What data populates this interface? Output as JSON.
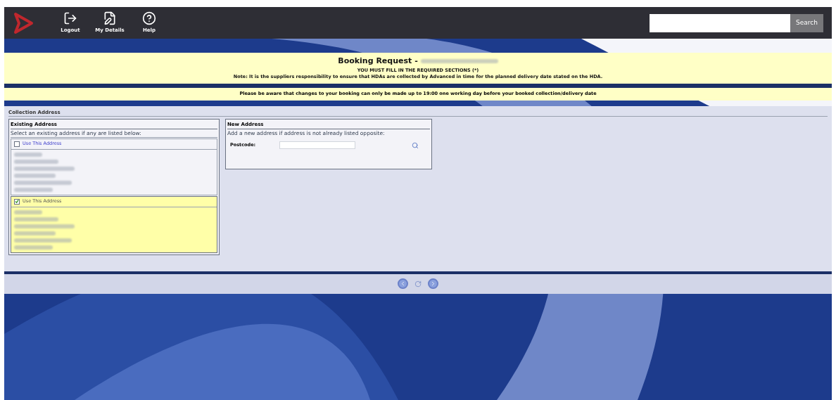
{
  "nav": [
    {
      "label": "Logout",
      "kind": "logout"
    },
    {
      "label": "My Details",
      "kind": "details"
    },
    {
      "label": "Help",
      "kind": "help"
    }
  ],
  "search": {
    "button": "Search"
  },
  "header": {
    "title": "Booking Request -",
    "required": "YOU MUST FILL IN THE REQUIRED SECTIONS (*)",
    "note": "Note: It is the suppliers responsibility to ensure that HDAs are collected by Advanced in time for the planned delivery date stated on the HDA."
  },
  "notice": "Please be aware that changes to your booking can only be made up to 19:00 one working day before your booked collection/delivery date",
  "collection": {
    "title": "Collection Address",
    "existing": {
      "title": "Existing Address",
      "hint": "Select an existing address if any are listed below:",
      "options": [
        {
          "label": "Use This Address",
          "selected": false
        },
        {
          "label": "Use This Address",
          "selected": true
        }
      ]
    },
    "new": {
      "title": "New Address",
      "hint": "Add a new address if address is not already listed opposite:",
      "postcode_label": "Postcode:"
    }
  }
}
